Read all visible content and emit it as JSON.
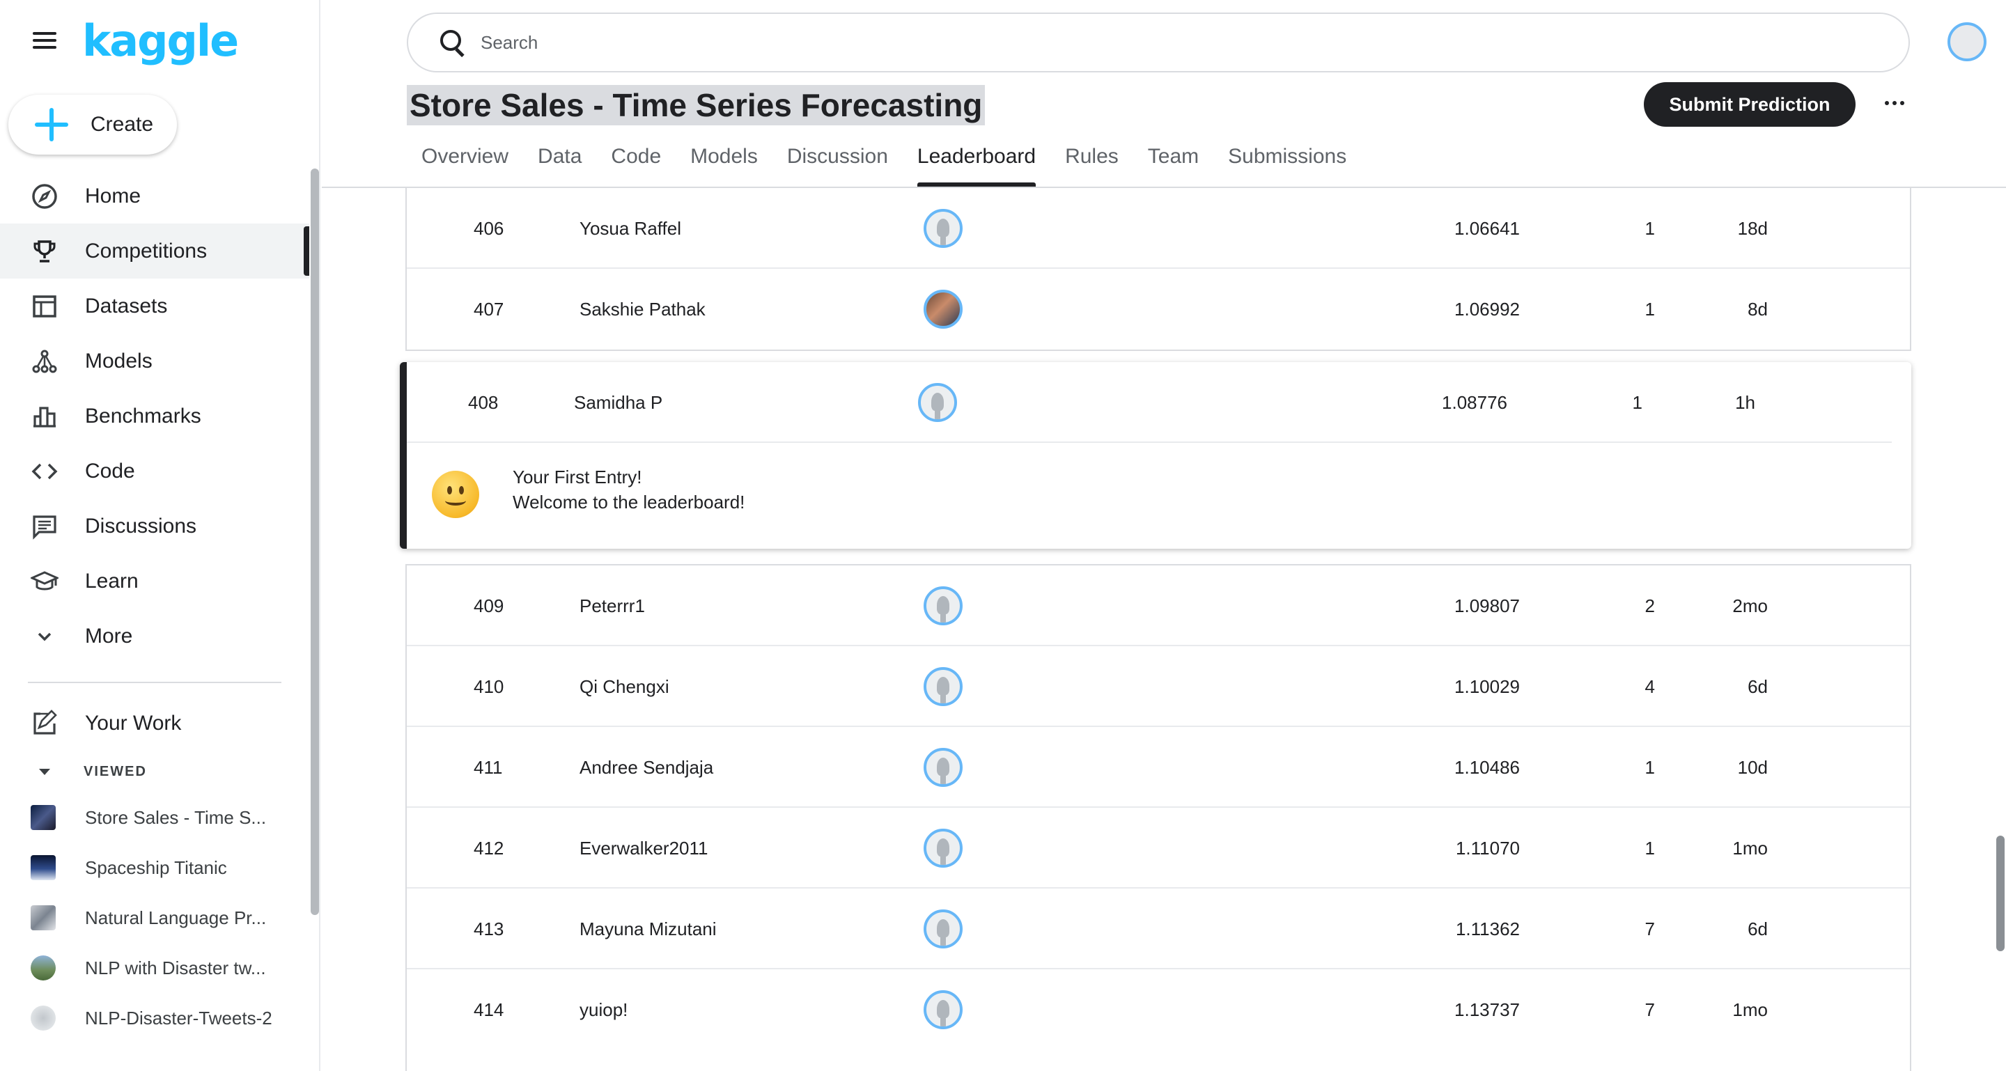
{
  "brand": {
    "logo_text": "kaggle",
    "accent": "#20beff"
  },
  "sidebar": {
    "create_label": "Create",
    "nav": [
      {
        "label": "Home",
        "icon": "compass-icon",
        "active": false
      },
      {
        "label": "Competitions",
        "icon": "trophy-icon",
        "active": true
      },
      {
        "label": "Datasets",
        "icon": "table-icon",
        "active": false
      },
      {
        "label": "Models",
        "icon": "model-graph-icon",
        "active": false
      },
      {
        "label": "Benchmarks",
        "icon": "bar-chart-icon",
        "active": false
      },
      {
        "label": "Code",
        "icon": "code-brackets-icon",
        "active": false
      },
      {
        "label": "Discussions",
        "icon": "comment-icon",
        "active": false
      },
      {
        "label": "Learn",
        "icon": "graduation-cap-icon",
        "active": false
      },
      {
        "label": "More",
        "icon": "chevron-down-icon",
        "active": false
      }
    ],
    "your_work_label": "Your Work",
    "viewed_header": "VIEWED",
    "viewed": [
      {
        "label": "Store Sales - Time S..."
      },
      {
        "label": "Spaceship Titanic"
      },
      {
        "label": "Natural Language Pr..."
      },
      {
        "label": "NLP with Disaster tw..."
      },
      {
        "label": "NLP-Disaster-Tweets-2"
      }
    ]
  },
  "header": {
    "search_placeholder": "Search",
    "title": "Store Sales - Time Series Forecasting",
    "submit_label": "Submit Prediction",
    "tabs": [
      {
        "label": "Overview",
        "active": false
      },
      {
        "label": "Data",
        "active": false
      },
      {
        "label": "Code",
        "active": false
      },
      {
        "label": "Models",
        "active": false
      },
      {
        "label": "Discussion",
        "active": false
      },
      {
        "label": "Leaderboard",
        "active": true
      },
      {
        "label": "Rules",
        "active": false
      },
      {
        "label": "Team",
        "active": false
      },
      {
        "label": "Submissions",
        "active": false
      }
    ]
  },
  "leaderboard": {
    "rows_above": [
      {
        "rank": "406",
        "name": "Yosua Raffel",
        "score": "1.06641",
        "entries": "1",
        "last": "18d",
        "avatar": "default"
      },
      {
        "rank": "407",
        "name": "Sakshie Pathak",
        "score": "1.06992",
        "entries": "1",
        "last": "8d",
        "avatar": "photo"
      }
    ],
    "highlight": {
      "rank": "408",
      "name": "Samidha P",
      "score": "1.08776",
      "entries": "1",
      "last": "1h",
      "message_title": "Your First Entry!",
      "message_body": "Welcome to the leaderboard!"
    },
    "rows_below": [
      {
        "rank": "409",
        "name": "Peterrr1",
        "score": "1.09807",
        "entries": "2",
        "last": "2mo",
        "avatar": "default"
      },
      {
        "rank": "410",
        "name": "Qi Chengxi",
        "score": "1.10029",
        "entries": "4",
        "last": "6d",
        "avatar": "default"
      },
      {
        "rank": "411",
        "name": "Andree Sendjaja",
        "score": "1.10486",
        "entries": "1",
        "last": "10d",
        "avatar": "default"
      },
      {
        "rank": "412",
        "name": "Everwalker2011",
        "score": "1.11070",
        "entries": "1",
        "last": "1mo",
        "avatar": "default"
      },
      {
        "rank": "413",
        "name": "Mayuna Mizutani",
        "score": "1.11362",
        "entries": "7",
        "last": "6d",
        "avatar": "default"
      },
      {
        "rank": "414",
        "name": "yuiop!",
        "score": "1.13737",
        "entries": "7",
        "last": "1mo",
        "avatar": "default"
      }
    ]
  }
}
